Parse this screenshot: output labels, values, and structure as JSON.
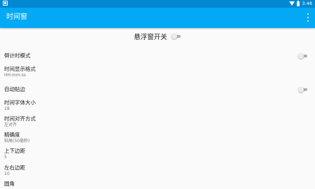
{
  "status_bar": {
    "time": "3:48",
    "wifi_icon": "wifi-icon",
    "battery_icon": "battery-icon"
  },
  "app_bar": {
    "title": "时间窗",
    "overflow_icon": "more-vertical-icon"
  },
  "master_switch": {
    "label": "悬浮窗开关",
    "on": false
  },
  "colors": {
    "status_bar": "#0288d1",
    "app_bar": "#03a9f4",
    "background": "#fafafa"
  },
  "settings": [
    {
      "title": "倒计时模式",
      "switch": false
    },
    {
      "title": "时间显示格式",
      "value": "HH:mm:ss"
    },
    {
      "title": "自动贴边",
      "switch": false
    },
    {
      "title": "时间字体大小",
      "value": "18"
    },
    {
      "title": "时间对齐方式",
      "value": "左对齐"
    },
    {
      "title": "精确度",
      "value": "较高(50毫秒)"
    },
    {
      "title": "上下边距",
      "value": "5"
    },
    {
      "title": "左右边距",
      "value": "10"
    },
    {
      "title": "圆角"
    }
  ]
}
